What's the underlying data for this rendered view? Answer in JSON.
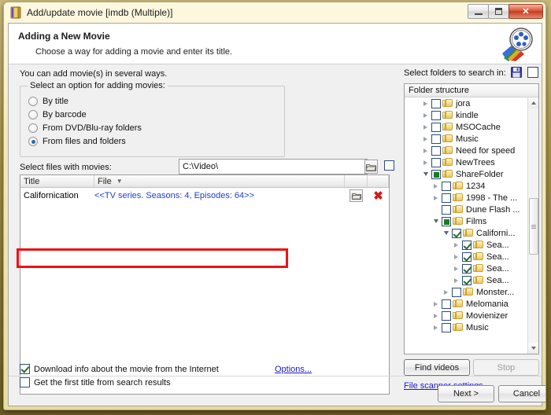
{
  "window": {
    "title": "Add/update movie [imdb (Multiple)]",
    "app_icon": "film-book-icon",
    "minimize_label": "Minimize",
    "maximize_label": "Maximize",
    "close_label": "✕"
  },
  "header": {
    "title": "Adding a New Movie",
    "subtitle": "Choose a way for adding a movie and enter its title.",
    "logo": "film-reel-icon"
  },
  "left": {
    "intro": "You can add movie(s) in several ways.",
    "group_legend": "Select an option for adding movies:",
    "options": [
      {
        "label": "By title",
        "selected": false
      },
      {
        "label": "By barcode",
        "selected": false
      },
      {
        "label": "From DVD/Blu-ray folders",
        "selected": false
      },
      {
        "label": "From files and folders",
        "selected": true
      }
    ],
    "path_label": "Select files with movies:",
    "path_value": "C:\\Video\\",
    "path_placeholder": "C:\\Video\\",
    "browse_icon": "open-folder-icon",
    "path_checkbox_checked": false,
    "list": {
      "columns": [
        {
          "key": "title",
          "label": "Title",
          "sort": ""
        },
        {
          "key": "file",
          "label": "File",
          "sort": "▼"
        },
        {
          "key": "browse",
          "label": ""
        },
        {
          "key": "delete",
          "label": ""
        }
      ],
      "rows": [
        {
          "title": "Californication",
          "file": "<<TV series. Seasons: 4, Episodes: 64>>",
          "browse_icon": "open-folder-icon",
          "delete_icon": "red-x-icon"
        }
      ]
    },
    "checkboxes": [
      {
        "label": "Download info about the movie from the Internet",
        "checked": true
      },
      {
        "label": "Get the first title from search results",
        "checked": false
      }
    ],
    "options_link": "Options..."
  },
  "right": {
    "title": "Select folders to search in:",
    "save_icon": "floppy-save-icon",
    "select_all_checked": false,
    "tree_header": "Folder structure",
    "tree": [
      {
        "label": "jora",
        "indent": 1,
        "arrow": "closed",
        "check": "off"
      },
      {
        "label": "kindle",
        "indent": 1,
        "arrow": "closed",
        "check": "off"
      },
      {
        "label": "MSOCache",
        "indent": 1,
        "arrow": "closed",
        "check": "off"
      },
      {
        "label": "Music",
        "indent": 1,
        "arrow": "closed",
        "check": "off"
      },
      {
        "label": "Need for speed",
        "indent": 1,
        "arrow": "closed",
        "check": "off"
      },
      {
        "label": "NewTrees",
        "indent": 1,
        "arrow": "closed",
        "check": "off"
      },
      {
        "label": "ShareFolder",
        "indent": 1,
        "arrow": "open",
        "check": "partial"
      },
      {
        "label": "1234",
        "indent": 2,
        "arrow": "closed",
        "check": "off"
      },
      {
        "label": "1998 - The ...",
        "indent": 2,
        "arrow": "closed",
        "check": "off"
      },
      {
        "label": "Dune Flash ...",
        "indent": 2,
        "arrow": "none",
        "check": "off"
      },
      {
        "label": "Films",
        "indent": 2,
        "arrow": "open",
        "check": "partial"
      },
      {
        "label": "Californi...",
        "indent": 3,
        "arrow": "open",
        "check": "on"
      },
      {
        "label": "Sea...",
        "indent": 4,
        "arrow": "closed",
        "check": "on"
      },
      {
        "label": "Sea...",
        "indent": 4,
        "arrow": "closed",
        "check": "on"
      },
      {
        "label": "Sea...",
        "indent": 4,
        "arrow": "closed",
        "check": "on"
      },
      {
        "label": "Sea...",
        "indent": 4,
        "arrow": "closed",
        "check": "on"
      },
      {
        "label": "Monster...",
        "indent": 3,
        "arrow": "closed",
        "check": "off"
      },
      {
        "label": "Melomania",
        "indent": 2,
        "arrow": "closed",
        "check": "off"
      },
      {
        "label": "Movienizer",
        "indent": 2,
        "arrow": "closed",
        "check": "off"
      },
      {
        "label": "Music",
        "indent": 2,
        "arrow": "closed",
        "check": "off"
      }
    ],
    "find_videos_label": "Find videos",
    "stop_label": "Stop",
    "stop_disabled": true,
    "file_scanner_link": "File scanner settings"
  },
  "footer": {
    "next_label": "Next >",
    "cancel_label": "Cancel"
  },
  "colors": {
    "link": "#1a1ad0",
    "list_file_text": "#1a3fd0",
    "annotation": "#ee1111",
    "checked_green": "#2d6a2d",
    "frame_gold": "#a08c45"
  }
}
